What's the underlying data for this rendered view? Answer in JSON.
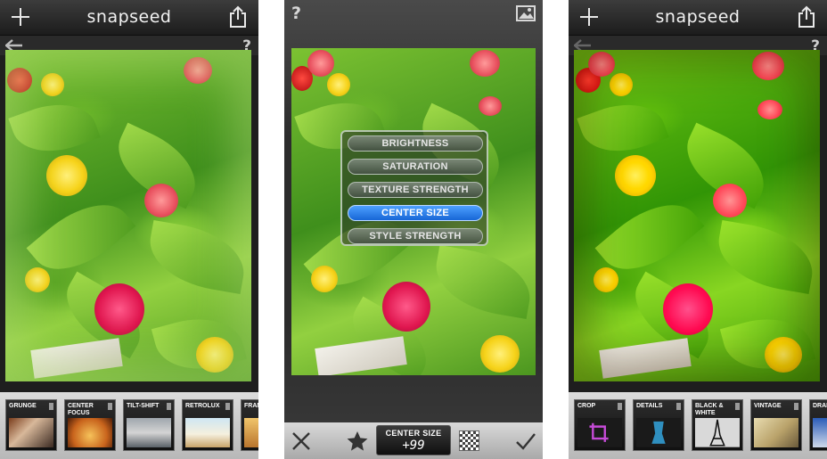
{
  "screens": [
    {
      "brand": "snapseed",
      "help": "?",
      "filters": [
        "GRUNGE",
        "CENTER FOCUS",
        "TILT-SHIFT",
        "RETROLUX",
        "FRAMES"
      ]
    },
    {
      "help": "?",
      "parameters": [
        "BRIGHTNESS",
        "SATURATION",
        "TEXTURE STRENGTH",
        "CENTER SIZE",
        "STYLE STRENGTH"
      ],
      "selected_parameter_index": 3,
      "readout_name": "CENTER SIZE",
      "readout_value": "+99"
    },
    {
      "brand": "snapseed",
      "help": "?",
      "filters": [
        "CROP",
        "DETAILS",
        "BLACK & WHITE",
        "VINTAGE",
        "DRAMA"
      ]
    }
  ],
  "colors": {
    "accent_blue": "#1f78e6",
    "bar_dark": "#1c1c1c",
    "filmstrip": "#c8c8c8"
  },
  "icons": {
    "add": "plus-icon",
    "share": "share-icon",
    "undo": "back-arrow-icon",
    "help": "help-icon",
    "compare": "image-compare-icon",
    "cancel": "close-icon",
    "favorite": "star-icon",
    "style": "checker-icon",
    "apply": "checkmark-icon"
  }
}
